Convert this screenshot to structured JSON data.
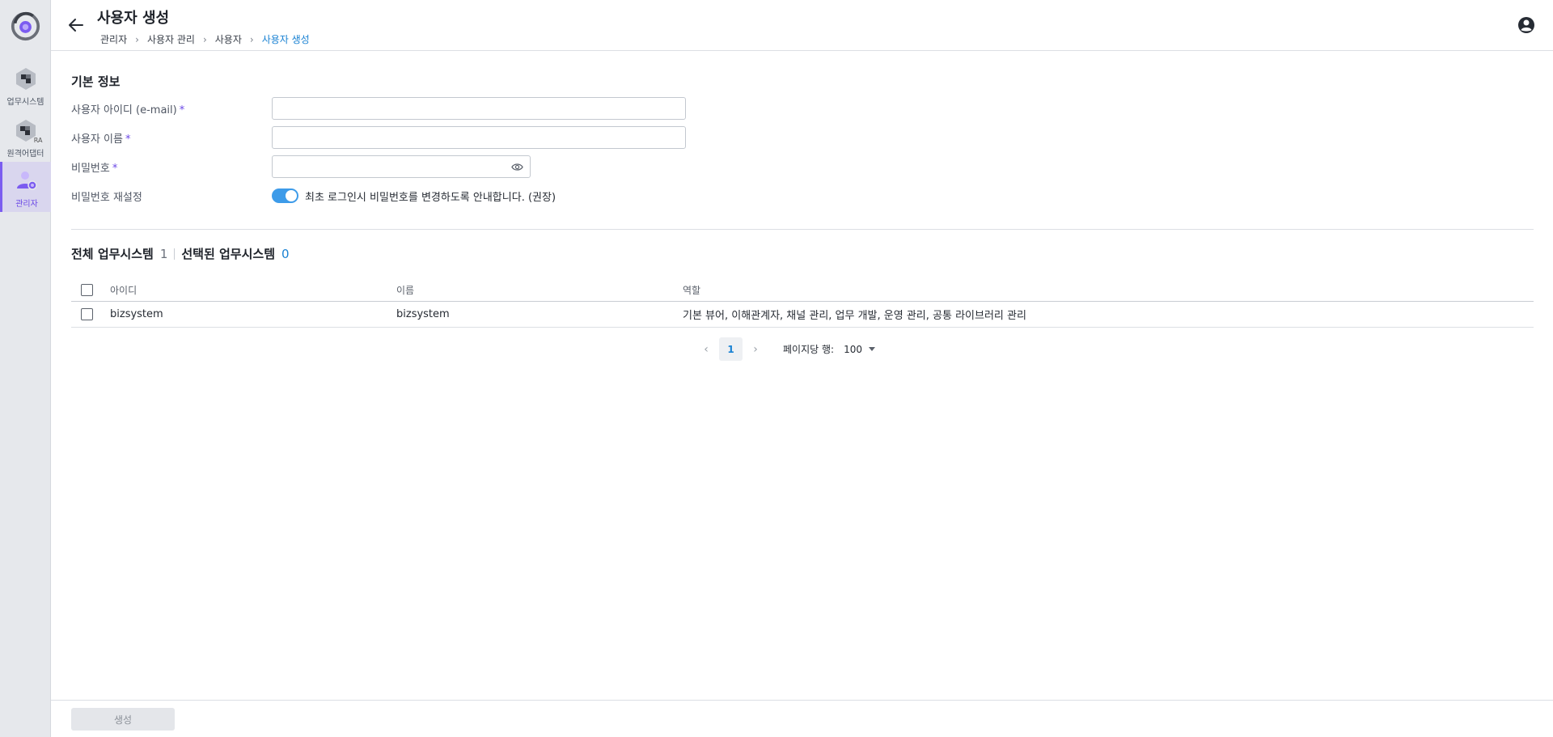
{
  "rail": {
    "items": [
      {
        "label": "업무시스템",
        "icon": "business-system-icon"
      },
      {
        "label": "원격어댑터",
        "icon": "remote-adapter-icon",
        "tag": "RA"
      },
      {
        "label": "관리자",
        "icon": "admin-user-icon",
        "active": true
      }
    ]
  },
  "header": {
    "title": "사용자 생성",
    "breadcrumb": [
      "관리자",
      "사용자 관리",
      "사용자",
      "사용자 생성"
    ]
  },
  "form": {
    "section_title": "기본 정보",
    "fields": {
      "user_id": {
        "label": "사용자 아이디 (e-mail)",
        "value": ""
      },
      "user_name": {
        "label": "사용자 이름",
        "value": ""
      },
      "password": {
        "label": "비밀번호",
        "value": ""
      },
      "reset": {
        "label": "비밀번호 재설정",
        "toggle_on": true,
        "text": "최초 로그인시 비밀번호를 변경하도록 안내합니다. (권장)"
      }
    },
    "required_mark": "*"
  },
  "systems": {
    "total_label": "전체 업무시스템",
    "total_count": "1",
    "selected_label": "선택된 업무시스템",
    "selected_count": "0",
    "columns": [
      "아이디",
      "이름",
      "역할"
    ],
    "rows": [
      {
        "id": "bizsystem",
        "name": "bizsystem",
        "roles": "기본 뷰어, 이해관계자, 채널 관리, 업무 개발, 운영 관리, 공통 라이브러리 관리"
      }
    ]
  },
  "pagination": {
    "current_page": "1",
    "rows_per_page_label": "페이지당 행:",
    "rows_per_page": "100"
  },
  "footer": {
    "create_label": "생성"
  },
  "colors": {
    "accent": "#6a47e6",
    "link": "#1a82d3",
    "toggle": "#3d9be9"
  }
}
